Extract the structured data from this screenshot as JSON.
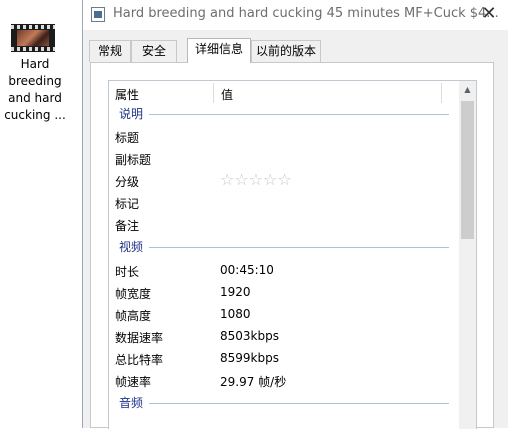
{
  "desktop": {
    "file_label_lines": [
      "Hard",
      "breeding",
      "and hard",
      "cucking ..."
    ]
  },
  "window": {
    "title": "Hard breeding and hard cucking 45 minutes MF+Cuck $4...",
    "close_glyph": "✕"
  },
  "tabs": [
    {
      "label": "常规"
    },
    {
      "label": "安全"
    },
    {
      "label": "详细信息",
      "active": true
    },
    {
      "label": "以前的版本"
    }
  ],
  "table": {
    "col_property": "属性",
    "col_value": "值"
  },
  "groups": {
    "description": "说明",
    "video": "视频",
    "audio": "音频"
  },
  "description_rows": [
    {
      "key": "标题",
      "value": ""
    },
    {
      "key": "副标题",
      "value": ""
    },
    {
      "key": "分级",
      "value": ""
    },
    {
      "key": "标记",
      "value": ""
    },
    {
      "key": "备注",
      "value": ""
    }
  ],
  "rating": {
    "stars_filled": 0,
    "stars_total": 5,
    "glyphs": "☆☆☆☆☆"
  },
  "video_rows": [
    {
      "key": "时长",
      "value": "00:45:10"
    },
    {
      "key": "帧宽度",
      "value": "1920"
    },
    {
      "key": "帧高度",
      "value": "1080"
    },
    {
      "key": "数据速率",
      "value": "8503kbps"
    },
    {
      "key": "总比特率",
      "value": "8599kbps"
    },
    {
      "key": "帧速率",
      "value": "29.97 帧/秒"
    }
  ],
  "scrollbar": {
    "up_glyph": "▲"
  }
}
